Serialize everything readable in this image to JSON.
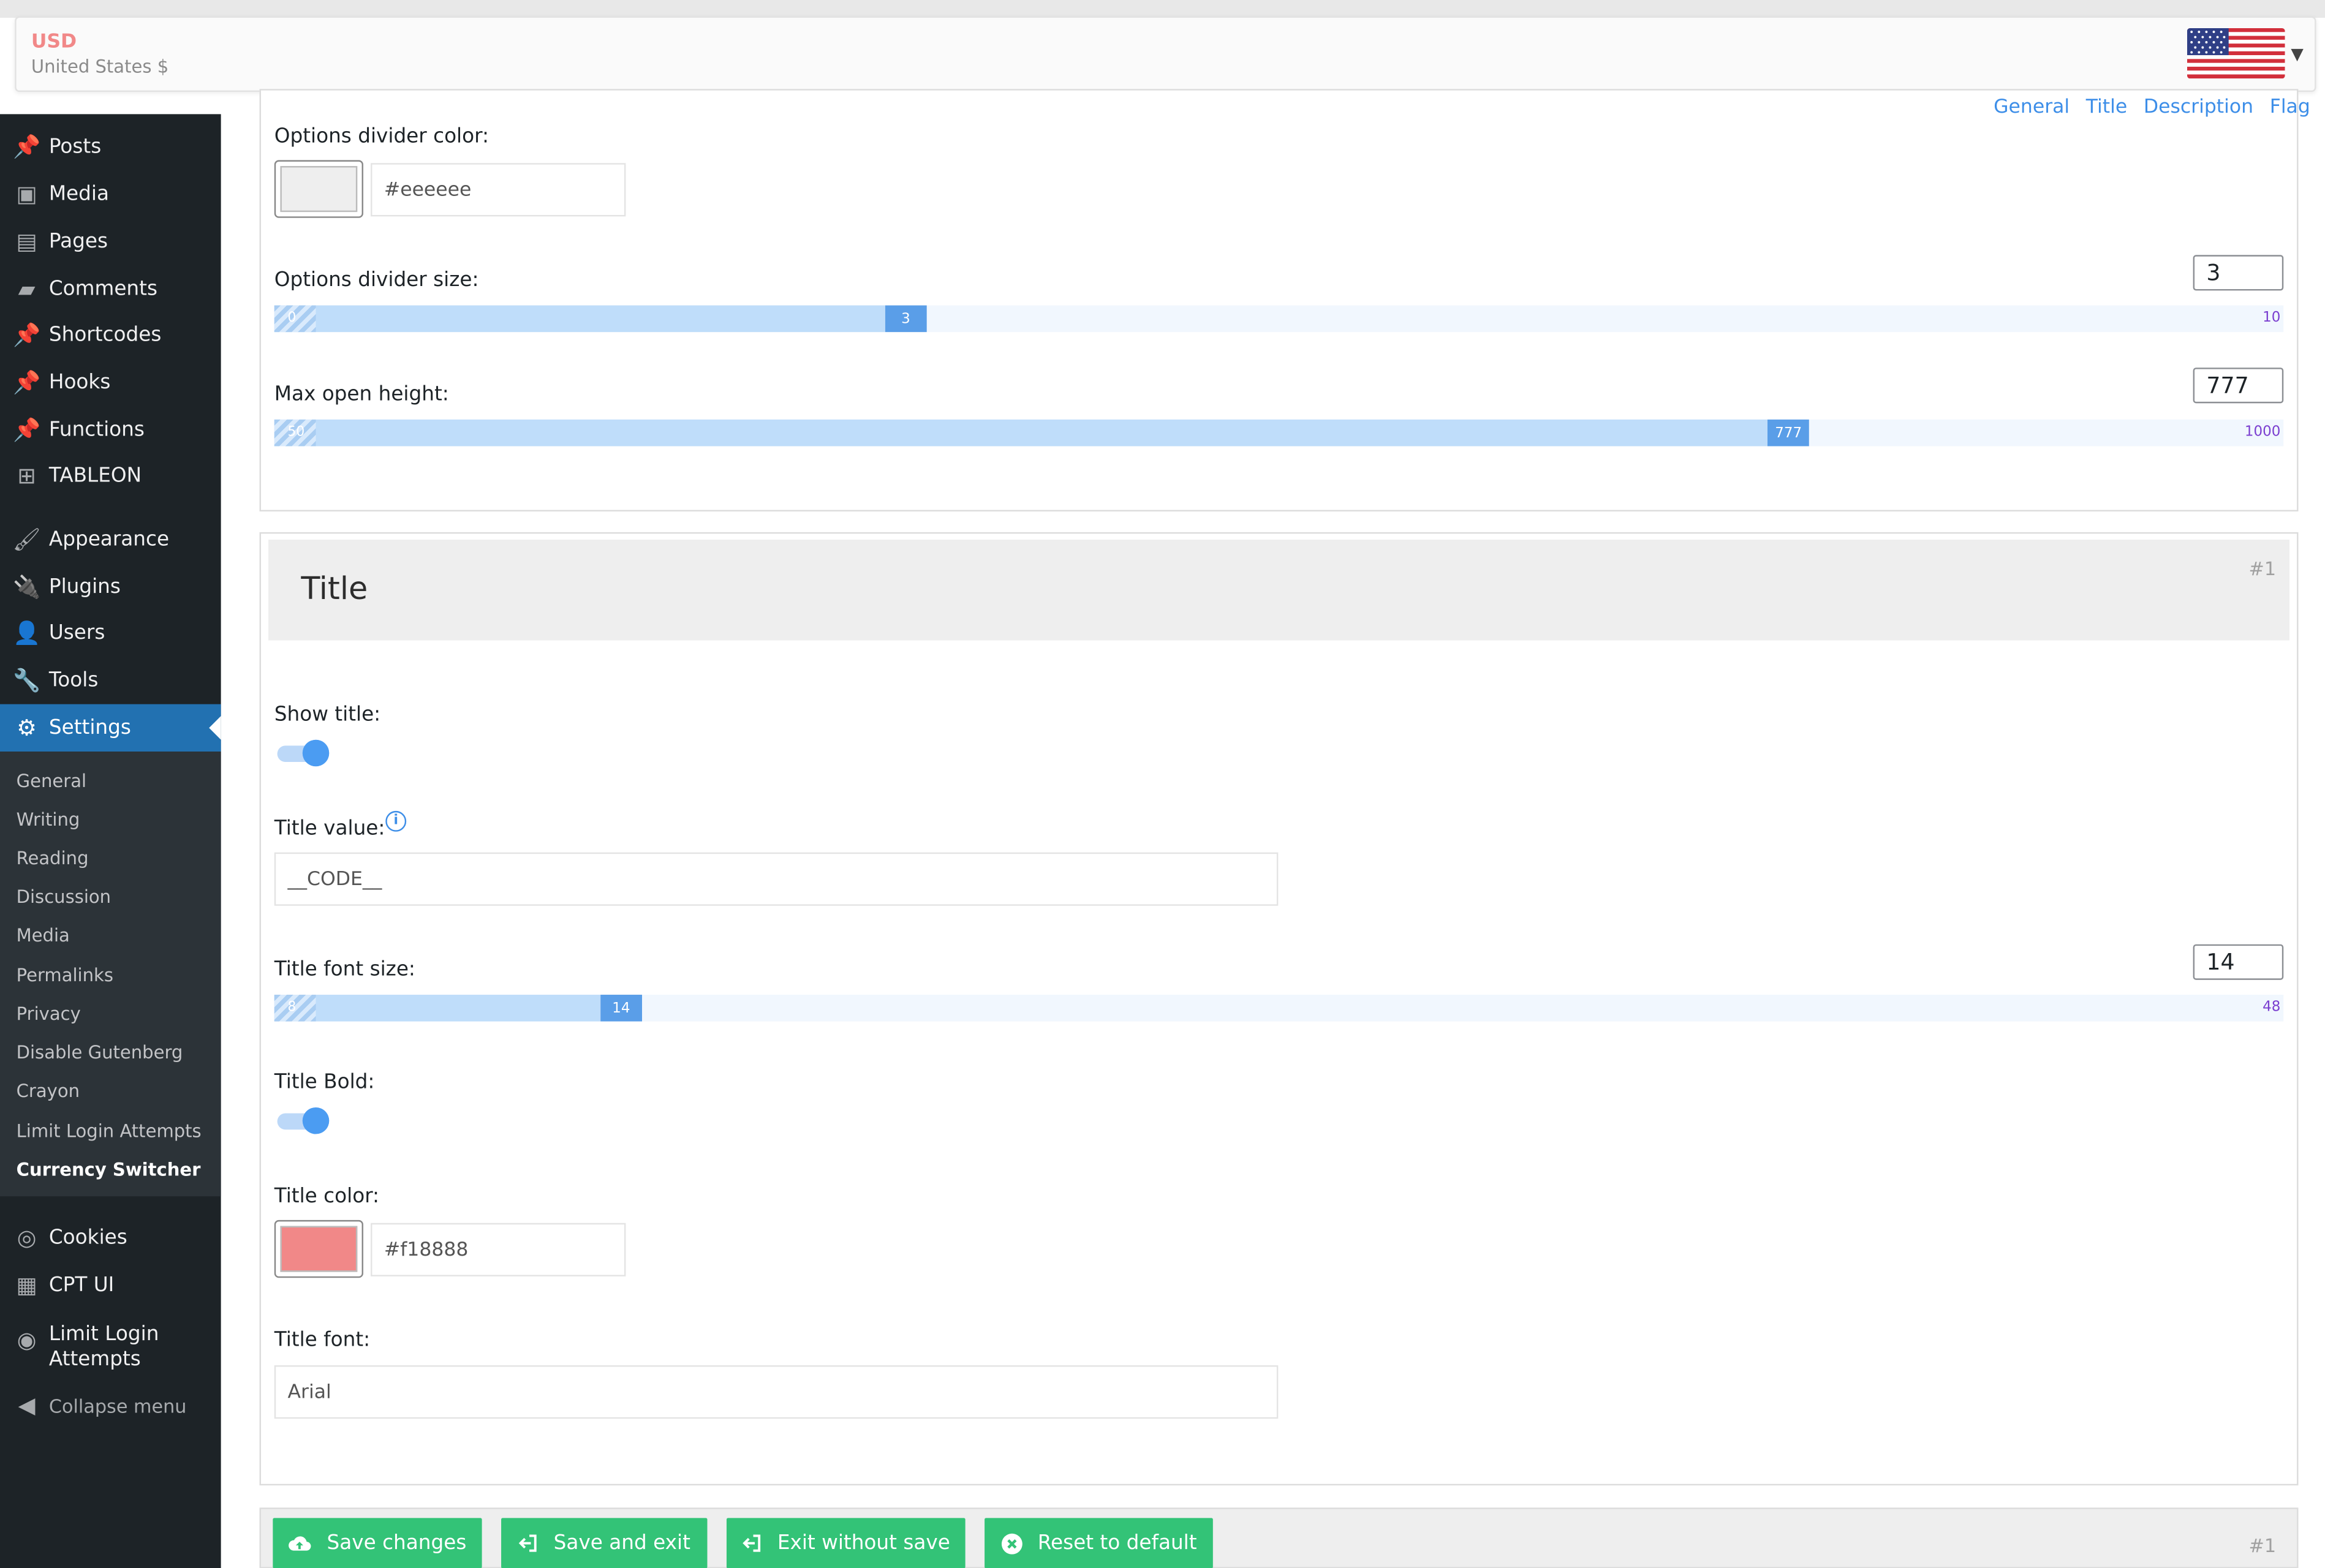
{
  "currency": {
    "code": "USD",
    "name": "United States $",
    "flag_icon": "us-flag-icon"
  },
  "tabs": [
    "General",
    "Title",
    "Description",
    "Flag"
  ],
  "sidebar": {
    "items": [
      {
        "label": "Posts",
        "icon": "pin-icon"
      },
      {
        "label": "Media",
        "icon": "media-icon"
      },
      {
        "label": "Pages",
        "icon": "pages-icon"
      },
      {
        "label": "Comments",
        "icon": "comment-icon"
      },
      {
        "label": "Shortcodes",
        "icon": "pin-icon"
      },
      {
        "label": "Hooks",
        "icon": "pin-icon"
      },
      {
        "label": "Functions",
        "icon": "pin-icon"
      },
      {
        "label": "TABLEON",
        "icon": "grid-icon"
      },
      {
        "label": "Appearance",
        "icon": "brush-icon"
      },
      {
        "label": "Plugins",
        "icon": "plugin-icon"
      },
      {
        "label": "Users",
        "icon": "user-icon"
      },
      {
        "label": "Tools",
        "icon": "wrench-icon"
      },
      {
        "label": "Settings",
        "icon": "settings-icon"
      }
    ],
    "submenu": [
      "General",
      "Writing",
      "Reading",
      "Discussion",
      "Media",
      "Permalinks",
      "Privacy",
      "Disable Gutenberg",
      "Crayon",
      "Limit Login Attempts",
      "Currency Switcher"
    ],
    "after_items": [
      {
        "label": "Cookies",
        "icon": "cookie-icon"
      },
      {
        "label": "CPT UI",
        "icon": "qr-icon"
      },
      {
        "label": "Limit Login Attempts",
        "icon": "fingerprint-icon"
      }
    ],
    "collapse": "Collapse menu"
  },
  "options_panel": {
    "divider_color_label": "Options divider color:",
    "divider_color_value": "#eeeeee",
    "divider_size_label": "Options divider size:",
    "divider_size": {
      "value": 3,
      "min": 0,
      "max": 10,
      "value_text": "3",
      "min_text": "0",
      "max_text": "10"
    },
    "max_height_label": "Max open height:",
    "max_height": {
      "value": 777,
      "min": 50,
      "max": 1000,
      "value_text": "777",
      "min_text": "50",
      "max_text": "1000"
    }
  },
  "title_section": {
    "heading": "Title",
    "number": "#1",
    "show_title_label": "Show title:",
    "show_title_on": true,
    "title_value_label": "Title value:",
    "title_value": "__CODE__",
    "font_size_label": "Title font size:",
    "font_size": {
      "value": 14,
      "min": 8,
      "max": 48,
      "value_text": "14",
      "min_text": "8",
      "max_text": "48"
    },
    "bold_label": "Title Bold:",
    "bold_on": true,
    "color_label": "Title color:",
    "color_value": "#f18888",
    "font_label": "Title font:",
    "font_value": "Arial"
  },
  "bottom": {
    "number": "#1",
    "buttons": {
      "save": "Save changes",
      "save_exit": "Save and exit",
      "exit": "Exit without save",
      "reset": "Reset to default"
    }
  },
  "colors": {
    "accent": "#3d8ee8",
    "button_green": "#33c377",
    "admin_active": "#2271b1",
    "currency_code": "#f18888"
  }
}
